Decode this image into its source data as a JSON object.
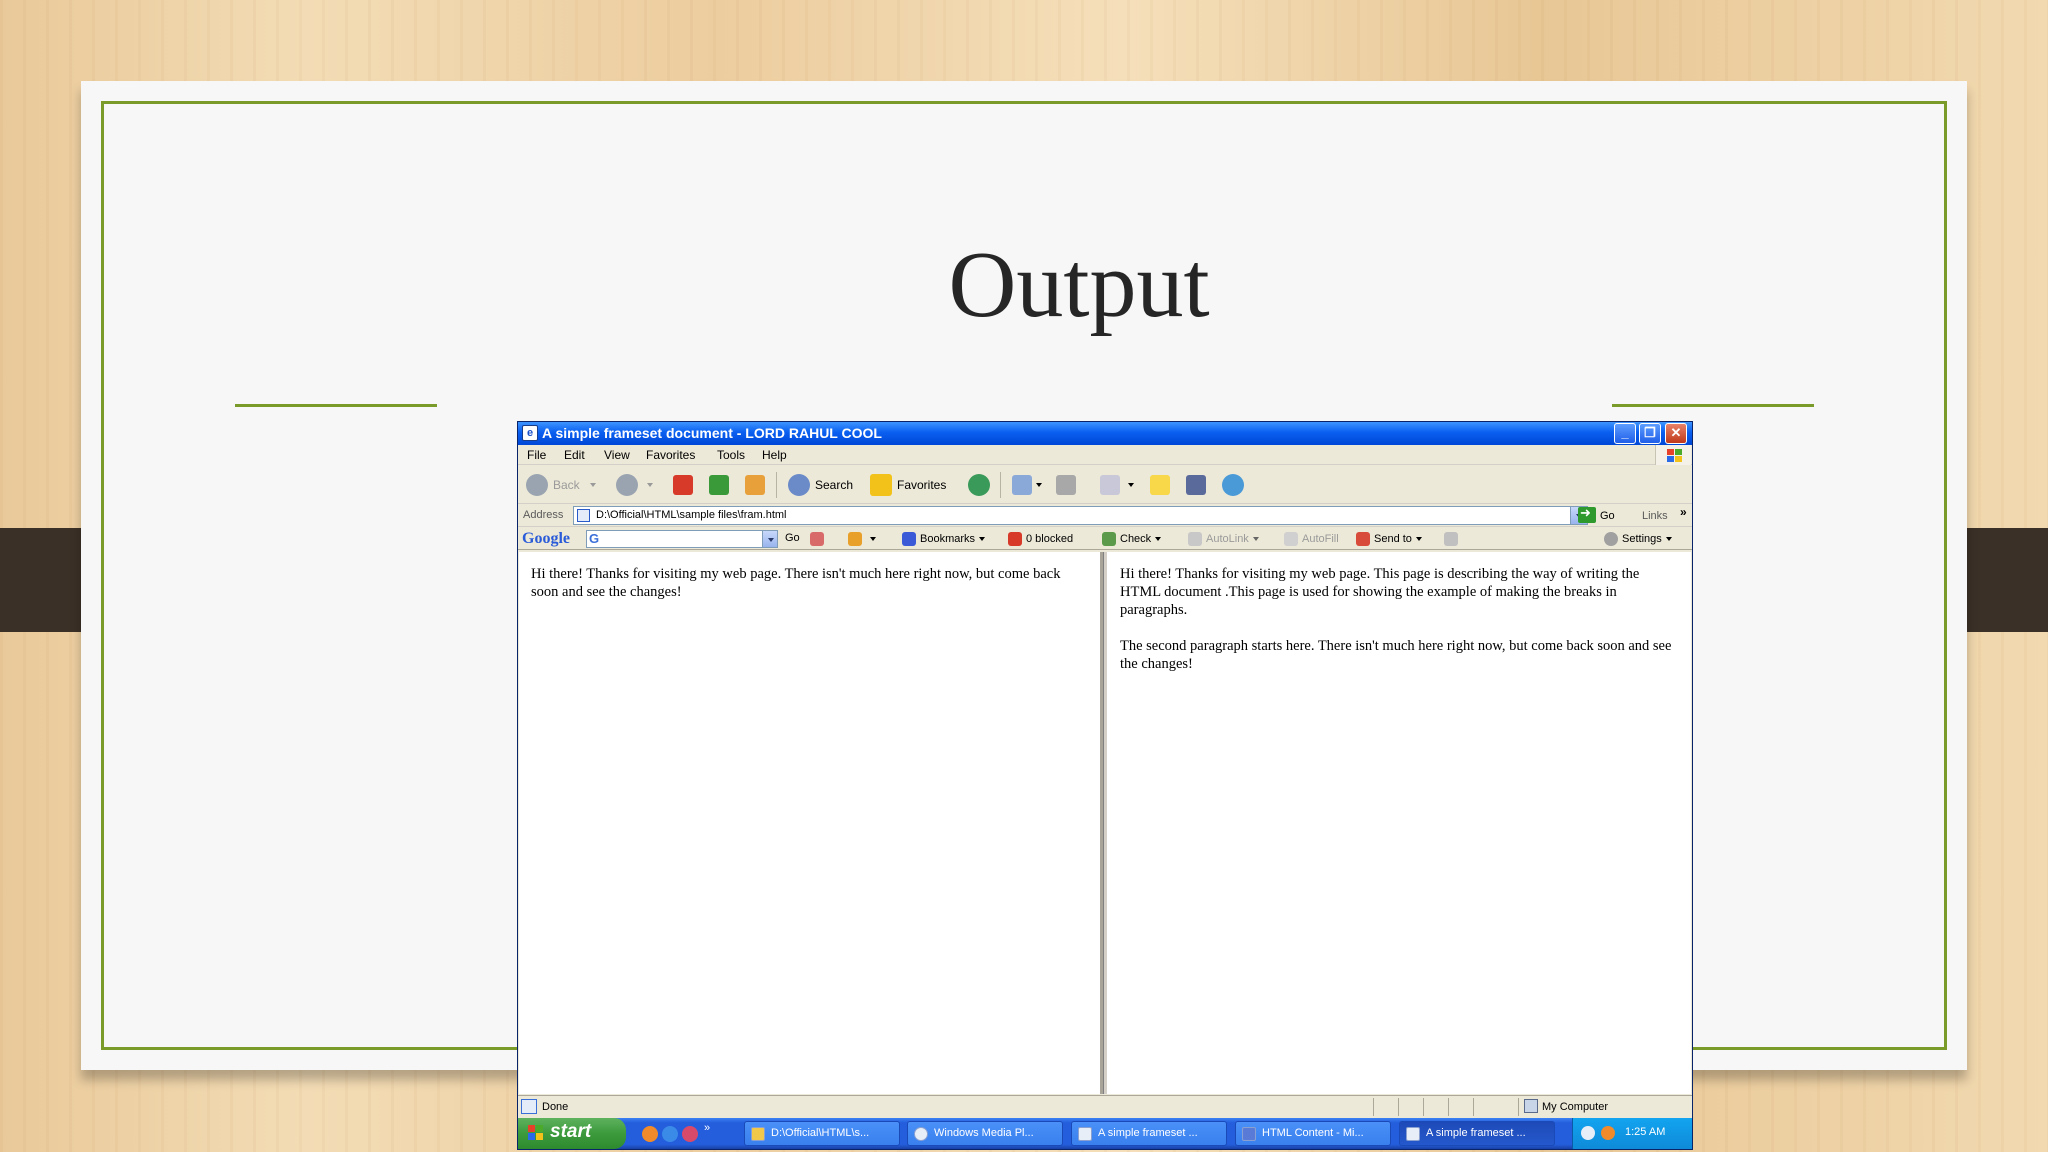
{
  "slide": {
    "title": "Output"
  },
  "window": {
    "title": "A simple frameset document - LORD RAHUL COOL",
    "controls": {
      "minimize": "_",
      "restore": "❐",
      "close": "✕"
    }
  },
  "menu": [
    "File",
    "Edit",
    "View",
    "Favorites",
    "Tools",
    "Help"
  ],
  "toolbar": {
    "back": "Back",
    "search": "Search",
    "favorites": "Favorites"
  },
  "address": {
    "label": "Address",
    "value": "D:\\Official\\HTML\\sample files\\fram.html",
    "go": "Go",
    "links": "Links",
    "more": "»"
  },
  "google_bar": {
    "logo": "Google",
    "field": "G",
    "go": "Go",
    "bookmarks": "Bookmarks",
    "blocked": "0 blocked",
    "check": "Check",
    "autolink": "AutoLink",
    "autofill": "AutoFill",
    "send_to": "Send to",
    "settings": "Settings"
  },
  "frames": {
    "left": {
      "p1": "Hi there! Thanks for visiting my web page. There isn't much here right now, but come back soon and see the changes!"
    },
    "right": {
      "p1": "Hi there! Thanks for visiting my web page. This page is describing the way of writing the HTML document .This page is used for showing the example of making the breaks in paragraphs.",
      "p2": "The second paragraph starts here. There isn't much here right now, but come back soon and see the changes!"
    }
  },
  "status": {
    "text": "Done",
    "zone": "My Computer"
  },
  "taskbar": {
    "start": "start",
    "tasks": [
      "D:\\Official\\HTML\\s...",
      "Windows Media Pl...",
      "A simple frameset ...",
      "HTML Content - Mi...",
      "A simple frameset ..."
    ],
    "clock": "1:25 AM",
    "quicklaunch_more": "»"
  },
  "colors": {
    "accent": "#7a9a2a",
    "titlebar": "#0a5ff0",
    "taskbar": "#245edc",
    "start": "#3c9a3c"
  }
}
